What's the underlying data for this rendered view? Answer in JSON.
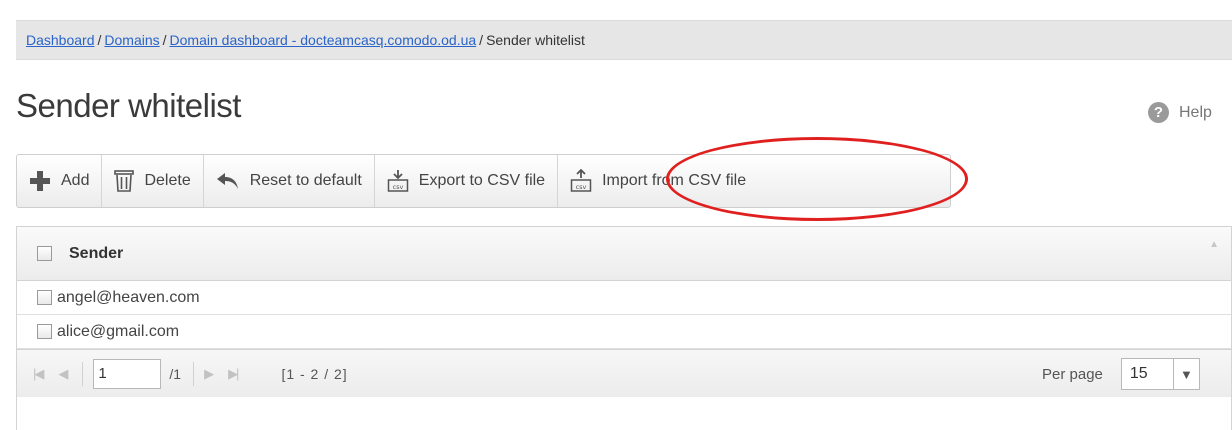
{
  "breadcrumb": {
    "items": [
      "Dashboard",
      "Domains",
      "Domain dashboard - docteamcasq.comodo.od.ua"
    ],
    "current": "Sender whitelist"
  },
  "page": {
    "title": "Sender whitelist",
    "help_label": "Help"
  },
  "toolbar": {
    "add": "Add",
    "delete": "Delete",
    "reset": "Reset to default",
    "export": "Export to CSV file",
    "import": "Import from CSV file"
  },
  "grid": {
    "column_header": "Sender",
    "rows": [
      "angel@heaven.com",
      "alice@gmail.com"
    ]
  },
  "pager": {
    "page_value": "1",
    "total_pages": "/1",
    "range": "[1 - 2 / 2]",
    "per_page_label": "Per page",
    "per_page_value": "15"
  },
  "colors": {
    "link": "#2a64c8",
    "highlight": "#e0201f",
    "add_icon": "#555555"
  }
}
